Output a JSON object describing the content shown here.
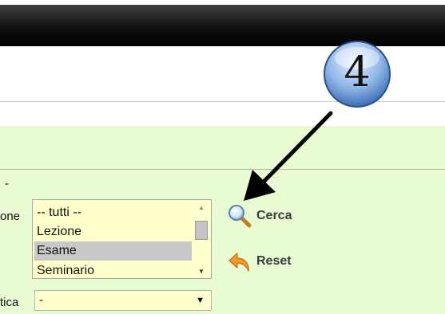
{
  "annotation": {
    "step_number": "4"
  },
  "form": {
    "dash_text": "-",
    "type_label": "one",
    "listbox": {
      "options": [
        "-- tutti --",
        "Lezione",
        "Esame",
        "Seminario"
      ],
      "selected": "Esame"
    },
    "second_label": "tica",
    "second_select_value": "-"
  },
  "buttons": {
    "search_label": "Cerca",
    "reset_label": "Reset"
  },
  "colors": {
    "form_background": "#e8fbd2",
    "field_background": "#ffffcc",
    "header_bar": "#111111"
  }
}
